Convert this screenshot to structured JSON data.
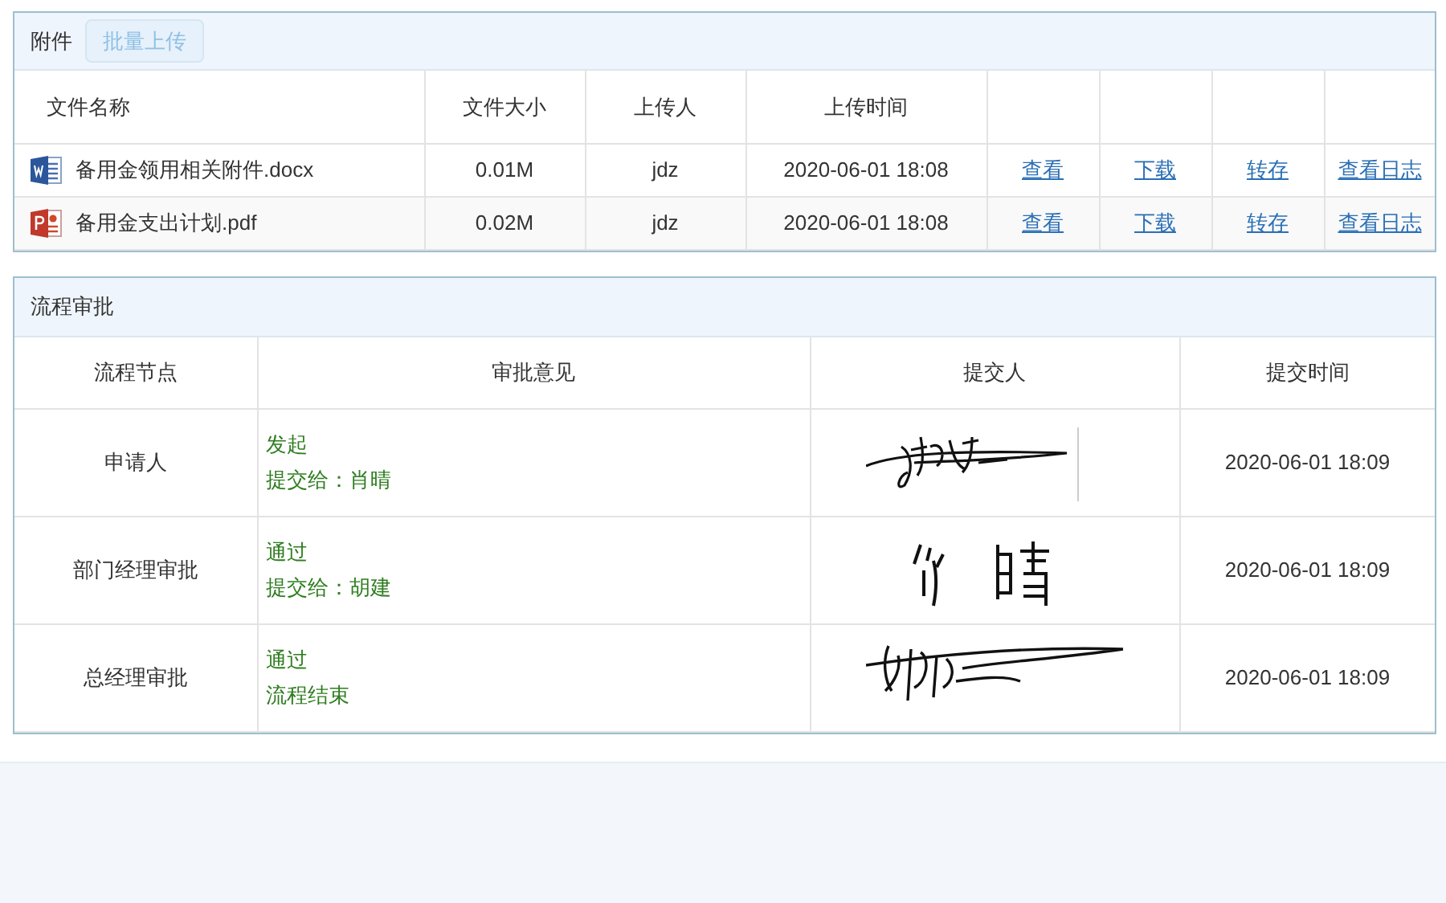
{
  "attachments": {
    "title": "附件",
    "upload_button": "批量上传",
    "columns": [
      "文件名称",
      "文件大小",
      "上传人",
      "上传时间"
    ],
    "rows": [
      {
        "kind": "word",
        "name": "备用金领用相关附件.docx",
        "size": "0.01M",
        "uploader": "jdz",
        "time": "2020-06-01 18:08",
        "actions": [
          "查看",
          "下载",
          "转存",
          "查看日志"
        ]
      },
      {
        "kind": "pdf",
        "name": "备用金支出计划.pdf",
        "size": "0.02M",
        "uploader": "jdz",
        "time": "2020-06-01 18:08",
        "actions": [
          "查看",
          "下载",
          "转存",
          "查看日志"
        ]
      }
    ]
  },
  "approval": {
    "title": "流程审批",
    "columns": [
      "流程节点",
      "审批意见",
      "提交人",
      "提交时间"
    ],
    "rows": [
      {
        "node": "申请人",
        "opinion": [
          "发起",
          "提交给：肖晴"
        ],
        "time": "2020-06-01 18:09"
      },
      {
        "node": "部门经理审批",
        "opinion": [
          "通过",
          "提交给：胡建"
        ],
        "time": "2020-06-01 18:09"
      },
      {
        "node": "总经理审批",
        "opinion": [
          "通过",
          "流程结束"
        ],
        "time": "2020-06-01 18:09"
      }
    ]
  }
}
